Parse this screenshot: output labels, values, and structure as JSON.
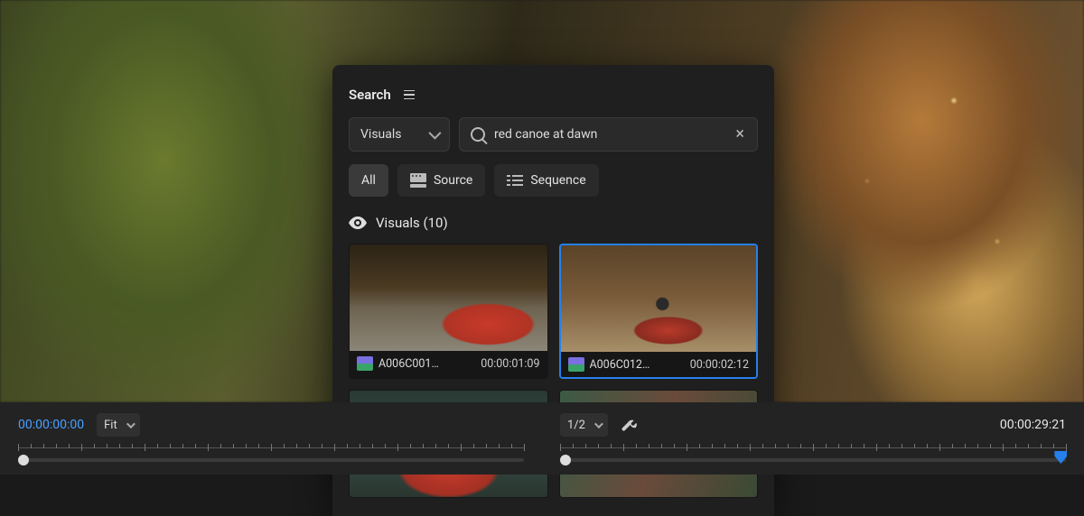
{
  "panel": {
    "title": "Search",
    "category_dropdown": "Visuals",
    "search_value": "red canoe at dawn",
    "chips": {
      "all": "All",
      "source": "Source",
      "sequence": "Sequence"
    },
    "section_label": "Visuals (10)"
  },
  "results": [
    {
      "name": "A006C001…",
      "tc": "00:00:01:09",
      "selected": false
    },
    {
      "name": "A006C012…",
      "tc": "00:00:02:12",
      "selected": true
    },
    {
      "name": "",
      "tc": "",
      "selected": false
    },
    {
      "name": "",
      "tc": "",
      "selected": false
    }
  ],
  "timeline": {
    "left_tc": "00:00:00:00",
    "fit_label": "Fit",
    "res_label": "1/2",
    "right_tc": "00:00:29:21"
  }
}
